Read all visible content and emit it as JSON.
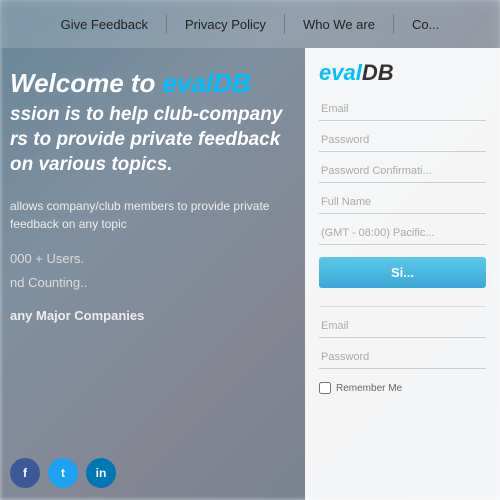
{
  "navbar": {
    "items": [
      {
        "label": "Give Feedback",
        "name": "give-feedback-nav"
      },
      {
        "label": "Privacy Policy",
        "name": "privacy-policy-nav"
      },
      {
        "label": "Who We are",
        "name": "who-we-are-nav"
      },
      {
        "label": "Co...",
        "name": "more-nav"
      }
    ]
  },
  "hero": {
    "welcome_prefix": "Welcome to ",
    "brand": "evalDB",
    "tagline_line1": "ssion is to help club-company",
    "tagline_line2": "rs to provide private feedback",
    "tagline_line3": "on various topics.",
    "description": "allows company/club members to\nprovide private feedback on any topic",
    "stat1": "000 + Users.",
    "stat2": "nd Counting..",
    "companies": "any Major Companies"
  },
  "form": {
    "brand": "eval",
    "email_placeholder": "Email",
    "password_placeholder": "Password",
    "password_confirm_placeholder": "Password Confirmati...",
    "fullname_placeholder": "Full Name",
    "timezone_placeholder": "(GMT - 08:00) Pacific...",
    "signup_button": "Si...",
    "login_email_placeholder": "Email",
    "login_password_placeholder": "Password",
    "remember_me_label": "Remember Me"
  },
  "social": {
    "facebook": "f",
    "twitter": "t",
    "linkedin": "in"
  },
  "colors": {
    "brand_blue": "#00bfff",
    "signup_btn": "#3aa8d8"
  }
}
